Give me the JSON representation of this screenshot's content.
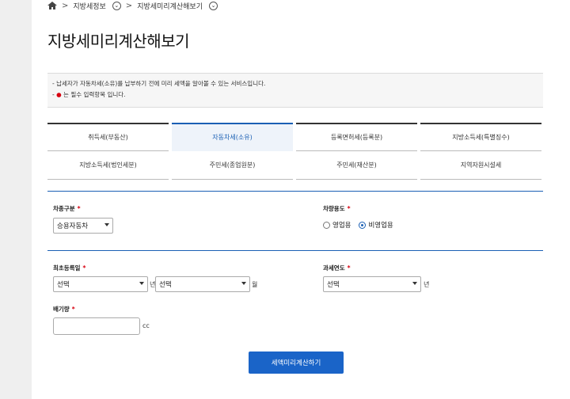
{
  "breadcrumb": {
    "item1": "지방세정보",
    "item2": "지방세미리계산해보기"
  },
  "page_title": "지방세미리계산해보기",
  "notice": {
    "line1": "- 납세자가 자동차세(소유)를 납부하기 전에 미리 세액을 알아볼 수 있는 서비스입니다.",
    "line2_prefix": "- ",
    "line2_dot": "●",
    "line2_text": "는 필수 입력항목 입니다."
  },
  "tabs": {
    "top": [
      "취득세(부동산)",
      "자동차세(소유)",
      "등록면허세(등록분)",
      "지방소득세(특별징수)"
    ],
    "bottom": [
      "지방소득세(법인세분)",
      "주민세(종업원분)",
      "주민세(재산분)",
      "지역자원시설세"
    ],
    "active": "자동차세(소유)"
  },
  "form": {
    "car_type_label": "차종구분",
    "car_type_value": "승용자동차",
    "usage_label": "차량용도",
    "usage_options": [
      "영업용",
      "비영업용"
    ],
    "usage_selected": "비영업용",
    "first_reg_label": "최초등록일",
    "first_reg_year_value": "선택",
    "year_unit": "년",
    "first_reg_month_value": "선택",
    "month_unit": "월",
    "tax_year_label": "과세연도",
    "tax_year_value": "선택",
    "tax_year_unit": "년",
    "displacement_label": "배기량",
    "displacement_value": "",
    "displacement_unit": "cc",
    "required_mark": "*"
  },
  "submit_label": "세액미리계산하기",
  "colors": {
    "accent": "#1a5fb4",
    "button": "#1a64c8",
    "required": "#d7000f"
  }
}
